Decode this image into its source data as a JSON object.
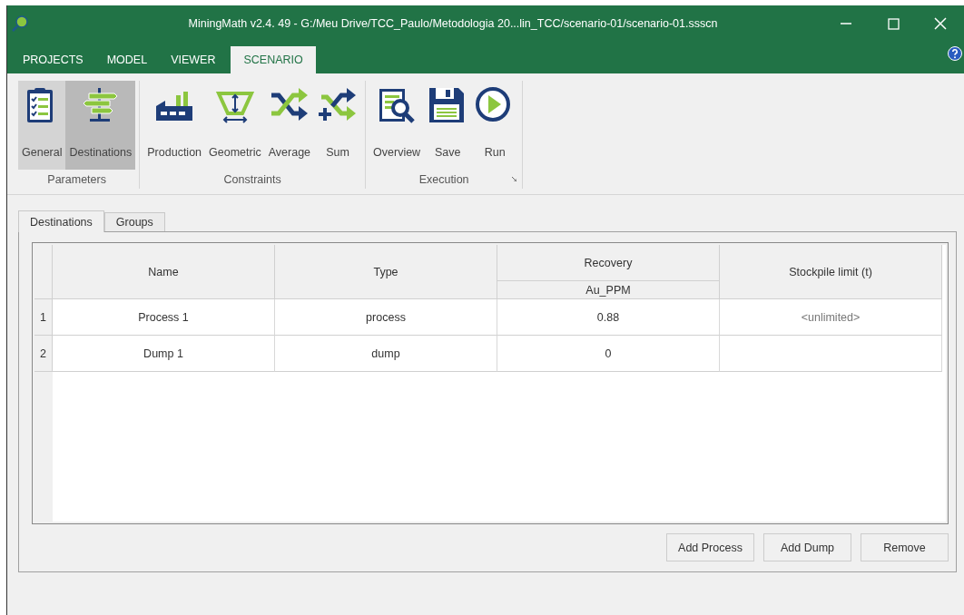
{
  "window": {
    "title": "MiningMath v2.4. 49 - G:/Meu Drive/TCC_Paulo/Metodologia 20...lin_TCC/scenario-01/scenario-01.ssscn"
  },
  "menu_tabs": [
    {
      "label": "PROJECTS",
      "selected": false
    },
    {
      "label": "MODEL",
      "selected": false
    },
    {
      "label": "VIEWER",
      "selected": false
    },
    {
      "label": "SCENARIO",
      "selected": true
    }
  ],
  "ribbon": [
    {
      "label": "Parameters",
      "buttons": [
        {
          "label": "General",
          "selected": false,
          "highlighted": true
        },
        {
          "label": "Destinations",
          "selected": true,
          "highlighted": false
        }
      ]
    },
    {
      "label": "Constraints",
      "buttons": [
        {
          "label": "Production",
          "selected": false,
          "highlighted": false
        },
        {
          "label": "Geometric",
          "selected": false,
          "highlighted": false
        },
        {
          "label": "Average",
          "selected": false,
          "highlighted": false
        },
        {
          "label": "Sum",
          "selected": false,
          "highlighted": false
        }
      ]
    },
    {
      "label": "Execution",
      "launcher": true,
      "buttons": [
        {
          "label": "Overview",
          "selected": false,
          "highlighted": false
        },
        {
          "label": "Save",
          "selected": false,
          "highlighted": false
        },
        {
          "label": "Run",
          "selected": false,
          "highlighted": false
        }
      ]
    }
  ],
  "sub_tabs": [
    {
      "label": "Destinations",
      "selected": true
    },
    {
      "label": "Groups",
      "selected": false
    }
  ],
  "table": {
    "columns": [
      {
        "label": "Name"
      },
      {
        "label": "Type"
      },
      {
        "label": "Recovery",
        "subcolumns": [
          "Au_PPM"
        ]
      },
      {
        "label": "Stockpile limit (t)"
      }
    ],
    "rows": [
      {
        "number": "1",
        "cells": [
          {
            "text": "Process 1"
          },
          {
            "text": "process"
          },
          {
            "text": "0.88"
          },
          {
            "text": "<unlimited>",
            "dim": true
          }
        ]
      },
      {
        "number": "2",
        "cells": [
          {
            "text": "Dump 1"
          },
          {
            "text": "dump"
          },
          {
            "text": "0"
          }
        ]
      }
    ]
  },
  "buttons": [
    "Add Process",
    "Add Dump",
    "Remove"
  ]
}
